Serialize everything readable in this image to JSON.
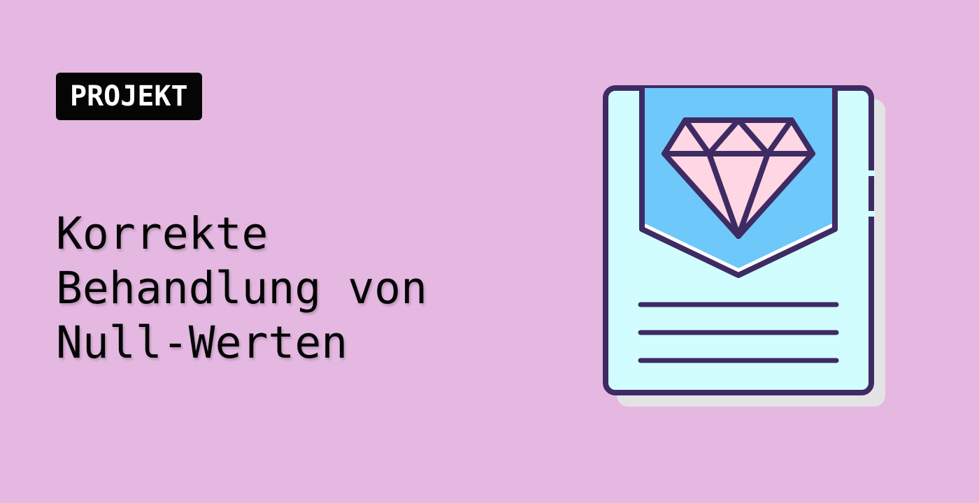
{
  "badge": {
    "label": "PROJEKT"
  },
  "title": {
    "lines": [
      "Korrekte",
      "Behandlung von",
      "Null-Werten"
    ]
  },
  "illustration": {
    "icon": "document-diamond-icon",
    "colors": {
      "outline": "#3e2b63",
      "paper": "#d2fdff",
      "ribbon": "#6ec8f9",
      "diamond": "#ffd6e4",
      "shadow": "#e3e3e5"
    }
  },
  "colors": {
    "background": "#e5b8e2",
    "badge_bg": "#050505",
    "badge_text": "#ffffff",
    "title_text": "#050505"
  }
}
